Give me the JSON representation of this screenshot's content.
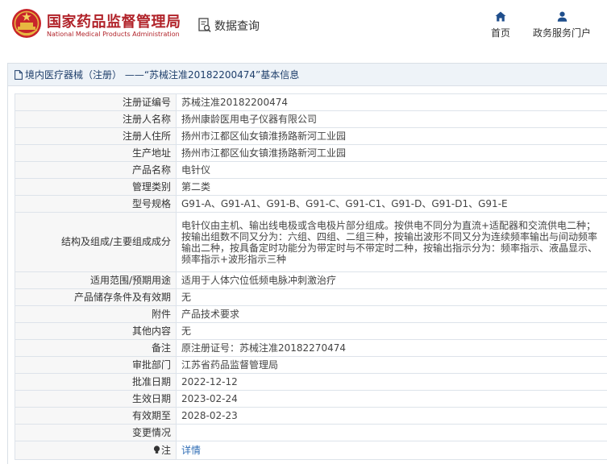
{
  "header": {
    "logo_cn": "国家药品监督管理局",
    "logo_en": "National Medical Products Administration",
    "query_label": "数据查询",
    "nav": [
      {
        "label": "首页",
        "icon": "home-icon"
      },
      {
        "label": "政务服务门户",
        "icon": "user-icon"
      }
    ]
  },
  "panel": {
    "title": "境内医疗器械（注册） ——“苏械注准20182200474”基本信息"
  },
  "rows": [
    {
      "label": "注册证编号",
      "value": "苏械注准20182200474"
    },
    {
      "label": "注册人名称",
      "value": "扬州康龄医用电子仪器有限公司"
    },
    {
      "label": "注册人住所",
      "value": "扬州市江都区仙女镇淮扬路新河工业园"
    },
    {
      "label": "生产地址",
      "value": "扬州市江都区仙女镇淮扬路新河工业园"
    },
    {
      "label": "产品名称",
      "value": "电针仪"
    },
    {
      "label": "管理类别",
      "value": "第二类"
    },
    {
      "label": "型号规格",
      "value": "G91-A、G91-A1、G91-B、G91-C、G91-C1、G91-D、G91-D1、G91-E"
    },
    {
      "label": "结构及组成/主要组成成分",
      "value": "电针仪由主机、输出线电极或含电极片部分组成。按供电不同分为直流+适配器和交流供电二种；按输出组数不同又分为：六组、四组、二组三种，按输出波形不同又分为连续频率输出与间动频率输出二种，按具备定时功能分为带定时与不带定时二种，按输出指示分为：频率指示、液晶显示、频率指示+波形指示三种"
    },
    {
      "label": "适用范围/预期用途",
      "value": "适用于人体穴位低频电脉冲刺激治疗"
    },
    {
      "label": "产品储存条件及有效期",
      "value": "无"
    },
    {
      "label": "附件",
      "value": "产品技术要求"
    },
    {
      "label": "其他内容",
      "value": "无"
    },
    {
      "label": "备注",
      "value": "原注册证号：苏械注准20182270474"
    },
    {
      "label": "审批部门",
      "value": "江苏省药品监督管理局"
    },
    {
      "label": "批准日期",
      "value": "2022-12-12"
    },
    {
      "label": "生效日期",
      "value": "2023-02-24"
    },
    {
      "label": "有效期至",
      "value": "2028-02-23"
    },
    {
      "label": "变更情况",
      "value": ""
    },
    {
      "label": "注",
      "value": "详情",
      "icon": "bulb-icon"
    }
  ],
  "colors": {
    "brand_red": "#b1232a",
    "title_blue": "#1f3f6b",
    "link_blue": "#2f6db5",
    "label_bg": "#f7f7f7",
    "panel_title_bg": "#eef3f8"
  }
}
